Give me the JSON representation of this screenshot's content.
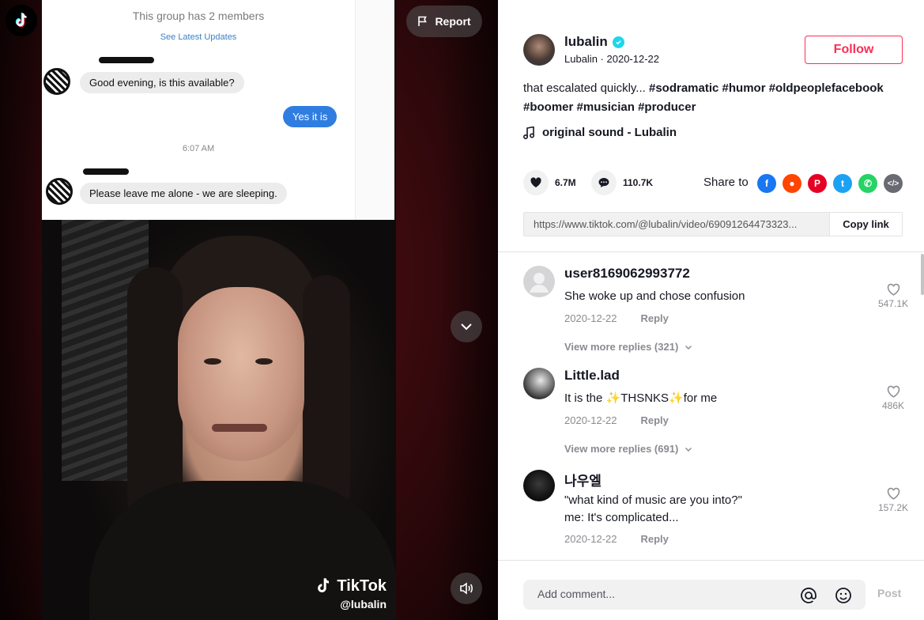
{
  "video": {
    "chat": {
      "group_text": "This group has 2 members",
      "latest_link": "See Latest Updates",
      "msg1": "Good evening, is this available?",
      "reply": "Yes it is",
      "time": "6:07 AM",
      "msg2": "Please leave me alone - we are sleeping."
    },
    "watermark_brand": "TikTok",
    "watermark_handle": "@lubalin",
    "report_label": "Report"
  },
  "author": {
    "username": "lubalin",
    "nickname": "Lubalin",
    "date": "2020-12-22",
    "follow_label": "Follow"
  },
  "caption": {
    "text": "that escalated quickly... ",
    "tags": [
      "#sodramatic",
      "#humor",
      "#oldpeoplefacebook",
      "#boomer",
      "#musician",
      "#producer"
    ]
  },
  "sound": {
    "label": "original sound - Lubalin"
  },
  "stats": {
    "likes": "6.7M",
    "comments": "110.7K",
    "share_label": "Share to"
  },
  "share": {
    "link": "https://www.tiktok.com/@lubalin/video/69091264473323...",
    "copy_label": "Copy link"
  },
  "comments": [
    {
      "user": "user8169062993772",
      "text": "She woke up and chose confusion",
      "date": "2020-12-22",
      "reply": "Reply",
      "likes": "547.1K",
      "more": "View more replies (321)"
    },
    {
      "user": "Little.lad",
      "text": "It is the ✨THSNKS✨for me",
      "date": "2020-12-22",
      "reply": "Reply",
      "likes": "486K",
      "more": "View more replies (691)"
    },
    {
      "user": "나우엘",
      "text_line1": "\"what kind of music are you into?\"",
      "text_line2": "me: It's complicated...",
      "date": "2020-12-22",
      "reply": "Reply",
      "likes": "157.2K"
    }
  ],
  "comment_box": {
    "placeholder": "Add comment...",
    "post_label": "Post"
  },
  "colors": {
    "accent": "#fe2c55",
    "verified": "#20d5ec"
  }
}
